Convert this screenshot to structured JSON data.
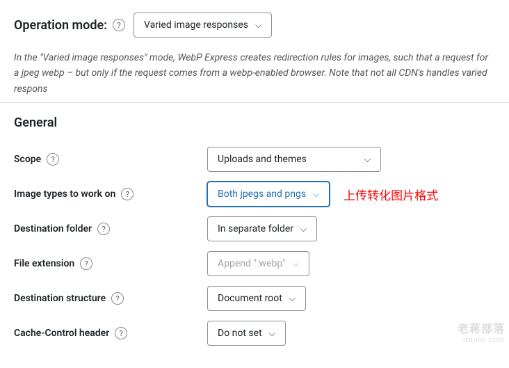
{
  "operation": {
    "label": "Operation mode:",
    "value": "Varied image responses",
    "description": "In the \"Varied image responses\" mode, WebP Express creates redirection rules for images, such that a request for a jpeg webp – but only if the request comes from a webp-enabled browser. Note that not all CDN's handles varied respons"
  },
  "general": {
    "title": "General",
    "fields": {
      "scope": {
        "label": "Scope",
        "value": "Uploads and themes"
      },
      "image_types": {
        "label": "Image types to work on",
        "value": "Both jpegs and pngs",
        "annotation": "上传转化图片格式"
      },
      "destination_folder": {
        "label": "Destination folder",
        "value": "In separate folder"
      },
      "file_extension": {
        "label": "File extension",
        "value": "Append \".webp\""
      },
      "destination_structure": {
        "label": "Destination structure",
        "value": "Document root"
      },
      "cache_control": {
        "label": "Cache-Control header",
        "value": "Do not set"
      }
    }
  },
  "watermark": {
    "line1": "老蒋部落",
    "line2": "itbulu.com"
  }
}
